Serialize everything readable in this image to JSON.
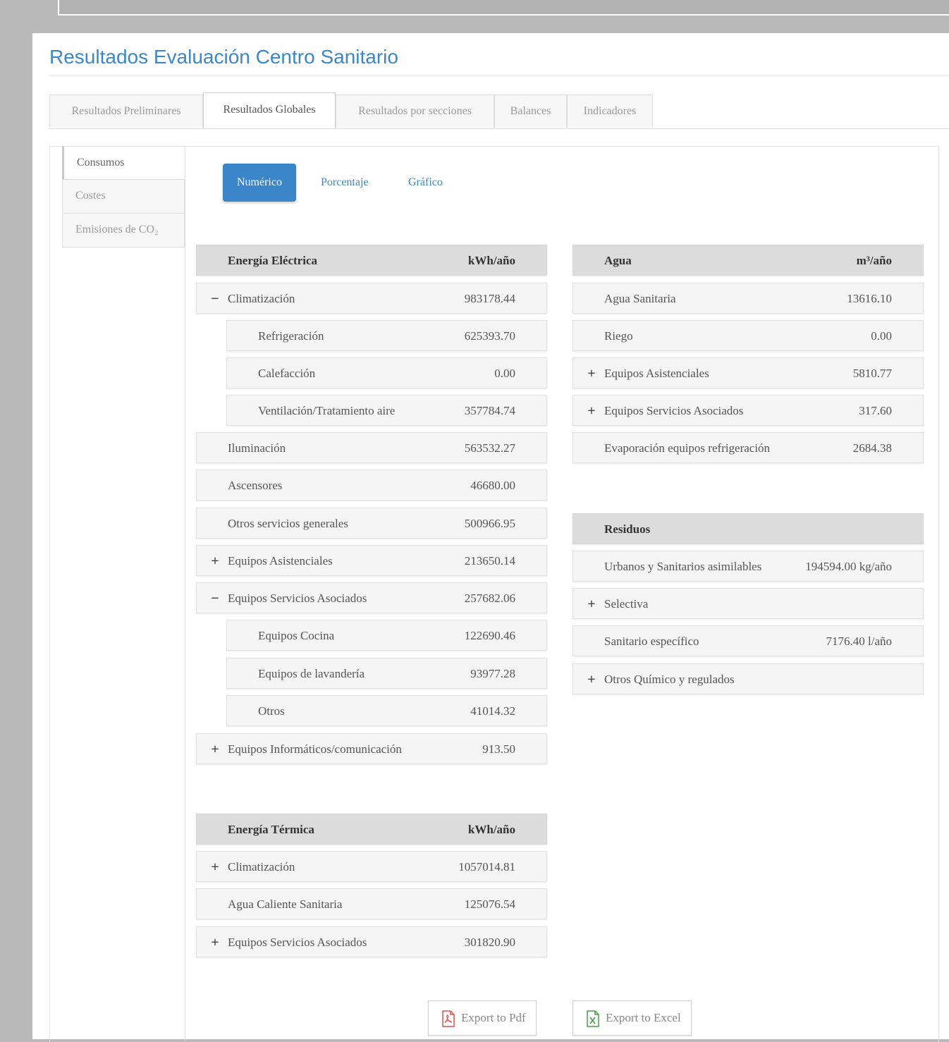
{
  "title": "Resultados Evaluación Centro Sanitario",
  "main_tabs": [
    {
      "label": "Resultados Preliminares"
    },
    {
      "label": "Resultados Globales"
    },
    {
      "label": "Resultados por secciones"
    },
    {
      "label": "Balances"
    },
    {
      "label": "Indicadores"
    }
  ],
  "side_tabs": [
    {
      "label": "Consumos"
    },
    {
      "label": "Costes"
    },
    {
      "label": "Emisiones de CO₂"
    }
  ],
  "view_pills": [
    {
      "label": "Numérico"
    },
    {
      "label": "Porcentaje"
    },
    {
      "label": "Gráfico"
    }
  ],
  "electric": {
    "title": "Energía Eléctrica",
    "unit": "kWh/año",
    "rows": [
      {
        "label": "Climatización",
        "value": "983178.44"
      },
      {
        "label": "Refrigeración",
        "value": "625393.70"
      },
      {
        "label": "Calefacción",
        "value": "0.00"
      },
      {
        "label": "Ventilación/Tratamiento aire",
        "value": "357784.74"
      },
      {
        "label": "Iluminación",
        "value": "563532.27"
      },
      {
        "label": "Ascensores",
        "value": "46680.00"
      },
      {
        "label": "Otros servicios generales",
        "value": "500966.95"
      },
      {
        "label": "Equipos Asistenciales",
        "value": "213650.14"
      },
      {
        "label": "Equipos Servicios Asociados",
        "value": "257682.06"
      },
      {
        "label": "Equipos Cocina",
        "value": "122690.46"
      },
      {
        "label": "Equipos de lavandería",
        "value": "93977.28"
      },
      {
        "label": "Otros",
        "value": "41014.32"
      },
      {
        "label": "Equipos Informáticos/comunicación",
        "value": "913.50"
      }
    ]
  },
  "thermal": {
    "title": "Energía Térmica",
    "unit": "kWh/año",
    "rows": [
      {
        "label": "Climatización",
        "value": "1057014.81"
      },
      {
        "label": "Agua Caliente Sanitaria",
        "value": "125076.54"
      },
      {
        "label": "Equipos Servicios Asociados",
        "value": "301820.90"
      }
    ]
  },
  "water": {
    "title": "Agua",
    "unit": "m³/año",
    "rows": [
      {
        "label": "Agua Sanitaria",
        "value": "13616.10"
      },
      {
        "label": "Riego",
        "value": "0.00"
      },
      {
        "label": "Equipos Asistenciales",
        "value": "5810.77"
      },
      {
        "label": "Equipos Servicios Asociados",
        "value": "317.60"
      },
      {
        "label": "Evaporación equipos refrigeración",
        "value": "2684.38"
      }
    ]
  },
  "waste": {
    "title": "Residuos",
    "rows": [
      {
        "label": "Urbanos y Sanitarios asimilables",
        "value": "194594.00 kg/año"
      },
      {
        "label": "Selectiva",
        "value": ""
      },
      {
        "label": "Sanitario específico",
        "value": "7176.40 l/año"
      },
      {
        "label": "Otros Químico y regulados",
        "value": ""
      }
    ]
  },
  "export": {
    "pdf": "Export to Pdf",
    "excel": "Export to Excel"
  },
  "icons": {
    "expand": "+",
    "collapse": "−"
  },
  "colors": {
    "accent": "#3a86c9",
    "title": "#3d87c6"
  }
}
